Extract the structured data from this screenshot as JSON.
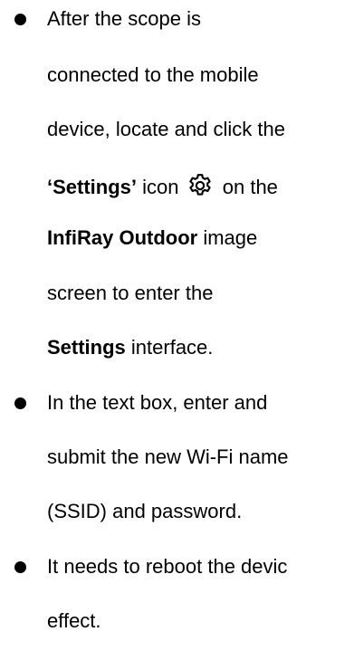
{
  "bullets": [
    {
      "lines": {
        "l1": "After the scope is",
        "l2": "connected to the mobile",
        "l3": "device, locate and click the",
        "l4_bold": "‘Settings’",
        "l4_mid": " icon",
        "l4_end": "on the",
        "l5_bold": "InfiRay Outdoor",
        "l5_end": " image",
        "l6": "screen to enter the",
        "l7_bold": "Settings",
        "l7_end": " interface."
      }
    },
    {
      "lines": {
        "l1": "In the text box, enter and",
        "l2": "submit the new Wi-Fi name",
        "l3": "(SSID) and password."
      }
    },
    {
      "lines": {
        "l1": "It needs to reboot the devic",
        "l2": "effect."
      }
    }
  ],
  "icons": {
    "settings": "gear-icon"
  }
}
